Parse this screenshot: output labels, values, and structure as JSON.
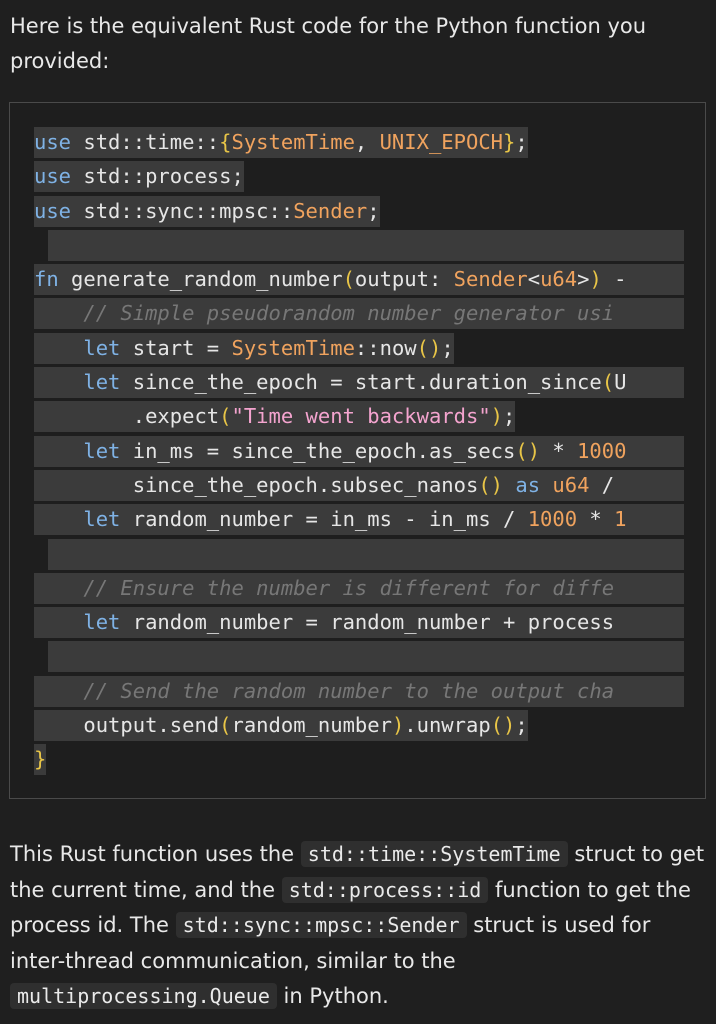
{
  "intro": "Here is the equivalent Rust code for the Python function you provided:",
  "code_lines": [
    "use std::time::{SystemTime, UNIX_EPOCH};",
    "use std::process;",
    "use std::sync::mpsc::Sender;",
    "",
    "fn generate_random_number(output: Sender<u64>) -",
    "    // Simple pseudorandom number generator usi",
    "    let start = SystemTime::now();",
    "    let since_the_epoch = start.duration_since(U",
    "        .expect(\"Time went backwards\");",
    "    let in_ms = since_the_epoch.as_secs() * 1000",
    "        since_the_epoch.subsec_nanos() as u64 /",
    "    let random_number = in_ms - in_ms / 1000 * 1",
    "",
    "    // Ensure the number is different for diffe",
    "    let random_number = random_number + process",
    "",
    "    // Send the random number to the output cha",
    "    output.send(random_number).unwrap();",
    "}"
  ],
  "outro": {
    "t1": "This Rust function uses the ",
    "c1": "std::time::SystemTime",
    "t2": " struct to get the current time, and the ",
    "c2": "std::process::id",
    "t3": " function to get the process id. The ",
    "c3": "std::sync::mpsc::Sender",
    "t4": " struct is used for inter-thread communication, similar to the ",
    "c4": "multiprocessing.Queue",
    "t5": " in Python."
  }
}
